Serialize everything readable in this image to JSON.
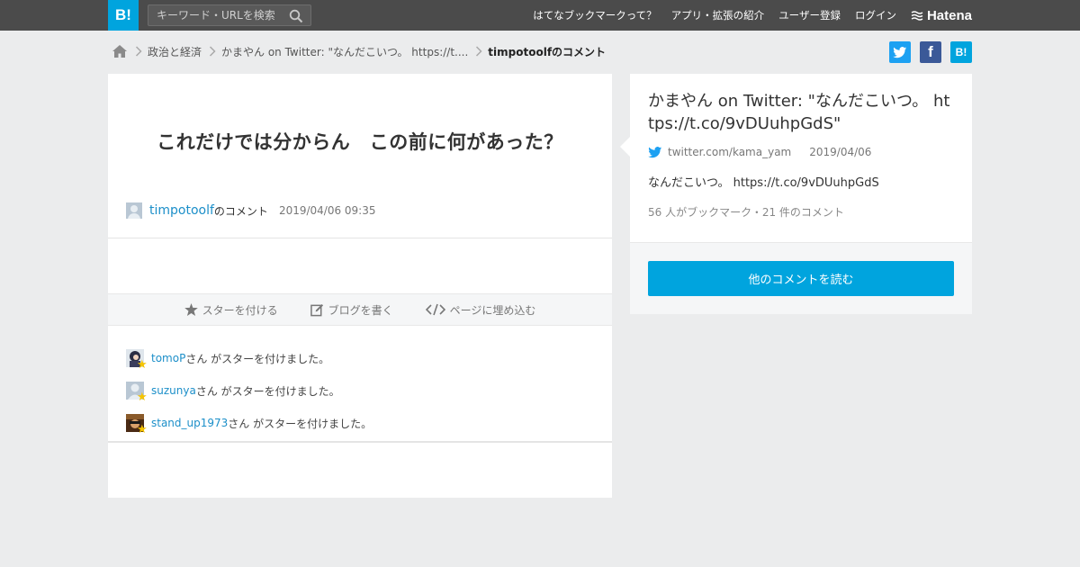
{
  "header": {
    "logo_text": "B!",
    "search_placeholder": "キーワード・URLを検索",
    "nav": [
      "はてなブックマークって？",
      "アプリ・拡張の紹介",
      "ユーザー登録",
      "ログイン"
    ],
    "brand": "Hatena"
  },
  "breadcrumb": {
    "items": [
      "政治と経済",
      "かまやん on Twitter: \"なんだこいつ。 https://t...."
    ],
    "current": "timpotoolfのコメント"
  },
  "share": {
    "twitter_label": "",
    "facebook_label": "f",
    "hatena_label": "B!"
  },
  "comment": {
    "text": "これだけでは分からん　この前に何があった？",
    "user": "timpotoolf",
    "user_suffix": "のコメント",
    "datetime": "2019/04/06 09:35"
  },
  "actions": {
    "star": "スターを付ける",
    "blog": "ブログを書く",
    "embed": "ページに埋め込む"
  },
  "stars": [
    {
      "user": "tomoP",
      "suffix": "さん がスターを付けました。"
    },
    {
      "user": "suzunya",
      "suffix": "さん がスターを付けました。"
    },
    {
      "user": "stand_up1973",
      "suffix": "さん がスターを付けました。"
    }
  ],
  "entry": {
    "title": "かまやん on Twitter: \"なんだこいつ。 https://t.co/9vDUuhpGdS\"",
    "domain": "twitter.com/kama_yam",
    "date": "2019/04/06",
    "description": "なんだこいつ。 https://t.co/9vDUuhpGdS",
    "count": "56 人がブックマーク・21 件のコメント",
    "read_more": "他のコメントを読む"
  },
  "colors": {
    "accent": "#00a4de",
    "twitter": "#1da1f2",
    "facebook": "#3b5998",
    "link": "#1c8fc9",
    "star": "#f5c400"
  }
}
